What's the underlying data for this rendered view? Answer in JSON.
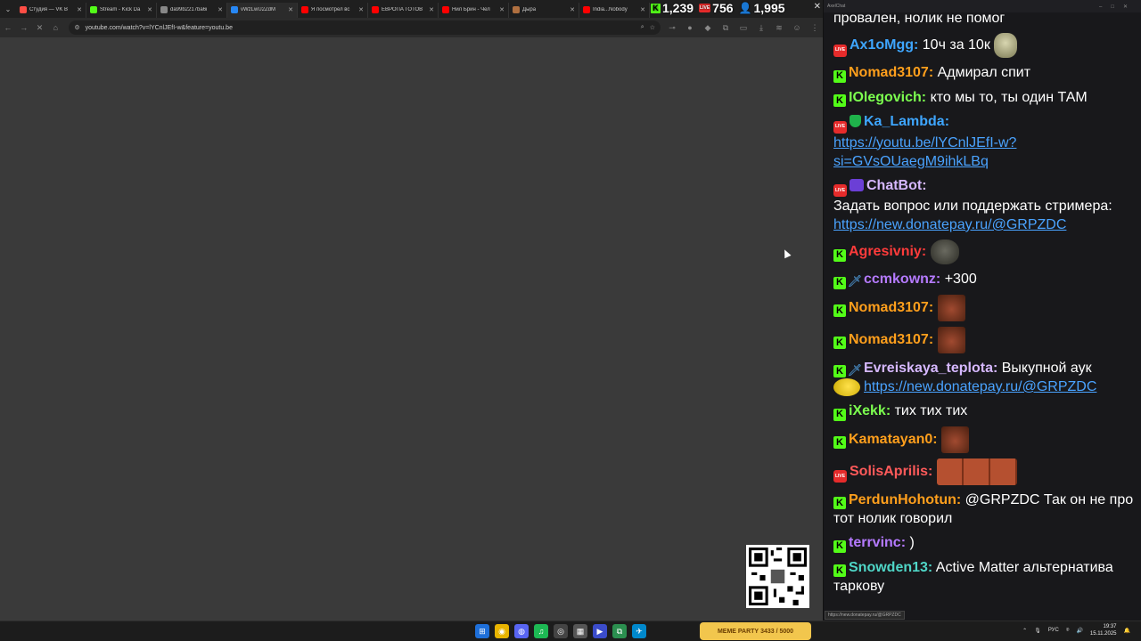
{
  "browser": {
    "tabs": [
      {
        "title": "Студия — VK В",
        "favicon_color": "#ff4e45"
      },
      {
        "title": "Stream - Kick Da",
        "favicon_color": "#53fc18"
      },
      {
        "title": "da99b2217ba6i",
        "favicon_color": "#888888"
      },
      {
        "title": "vWzLwU2ZdM",
        "favicon_color": "#2787f5"
      },
      {
        "title": "Я посмотрел вс",
        "favicon_color": "#ff0000"
      },
      {
        "title": "ЕВРОПА ГОТОВ",
        "favicon_color": "#ff0000"
      },
      {
        "title": "Нил Брин - Чел",
        "favicon_color": "#ff0000"
      },
      {
        "title": "Дыра",
        "favicon_color": "#b07040"
      },
      {
        "title": "India...Nobody",
        "favicon_color": "#ff0000"
      }
    ],
    "url": "youtube.com/watch?v=lYCnlJEfI-w&feature=youtu.be",
    "stream_stats": {
      "kick_viewers": "1,239",
      "live_viewers": "756",
      "total_viewers": "1,995"
    }
  },
  "chat": {
    "window_title": "AxelChat",
    "messages": [
      {
        "nick": "",
        "text": "провален, нолик не помог",
        "badges": [],
        "nick_color": "#ffffff"
      },
      {
        "nick": "Ax1oMgg:",
        "text": " 10ч за 10к",
        "badges": [
          "live"
        ],
        "nick_color": "#3ea6ff",
        "emote": "frog"
      },
      {
        "nick": "Nomad3107:",
        "text": " Адмирал спит",
        "badges": [
          "kick"
        ],
        "nick_color": "#ff9f1c"
      },
      {
        "nick": "IOlegovich:",
        "text": " кто мы то, ты один ТАМ",
        "badges": [
          "kick"
        ],
        "nick_color": "#7cff4f"
      },
      {
        "nick": "Ka_Lambda:",
        "text": "",
        "badges": [
          "live",
          "shield"
        ],
        "nick_color": "#3ea6ff",
        "link": "https://youtu.be/lYCnlJEfI-w?si=GVsOUaegM9ihkLBq"
      },
      {
        "nick": "ChatBot:",
        "text": "Задать вопрос или поддержать стримера:",
        "badges": [
          "live",
          "bot"
        ],
        "nick_color": "#d6b8ff",
        "link": "https://new.donatepay.ru/@GRPZDC"
      },
      {
        "nick": "Agresivniy:",
        "text": "",
        "badges": [
          "kick"
        ],
        "nick_color": "#ff3b3b",
        "emote": "blob"
      },
      {
        "nick": "ccmkownz:",
        "text": " +300",
        "badges": [
          "kick",
          "sword"
        ],
        "nick_color": "#b57aff"
      },
      {
        "nick": "Nomad3107:",
        "text": "",
        "badges": [
          "kick"
        ],
        "nick_color": "#ff9f1c",
        "emote": "face"
      },
      {
        "nick": "Nomad3107:",
        "text": "",
        "badges": [
          "kick"
        ],
        "nick_color": "#ff9f1c",
        "emote": "face"
      },
      {
        "nick": "Evreiskaya_teplota:",
        "text": " Выкупной аук",
        "badges": [
          "kick",
          "sword"
        ],
        "nick_color": "#d6b8ff",
        "link": "https://new.donatepay.ru/@GRPZDC",
        "emote_before_link": "duck"
      },
      {
        "nick": "iXekk:",
        "text": " тих тих тих",
        "badges": [
          "kick"
        ],
        "nick_color": "#7cff4f"
      },
      {
        "nick": "Kamatayan0:",
        "text": "",
        "badges": [
          "kick"
        ],
        "nick_color": "#ff9f1c",
        "emote": "face"
      },
      {
        "nick": "SolisAprilis:",
        "text": "",
        "badges": [
          "live"
        ],
        "nick_color": "#ff5a5a",
        "emote": "faces3"
      },
      {
        "nick": "PerdunHohotun:",
        "text": " @GRPZDC Так он не про тот нолик говорил",
        "badges": [
          "kick"
        ],
        "nick_color": "#ff9f1c"
      },
      {
        "nick": "terrvinc:",
        "text": " )",
        "badges": [
          "kick"
        ],
        "nick_color": "#b57aff"
      },
      {
        "nick": "Snowden13:",
        "text": " Active Matter альтернатива таркову",
        "badges": [
          "kick"
        ],
        "nick_color": "#4fd6c7"
      }
    ],
    "status_url": "https://new.donatepay.ru/@GRPZDC"
  },
  "taskbar": {
    "widget_title": "MEME PARTY",
    "widget_progress": "3433 / 5000",
    "lang": "РУС",
    "time": "19:37",
    "date": "15.11.2025"
  }
}
